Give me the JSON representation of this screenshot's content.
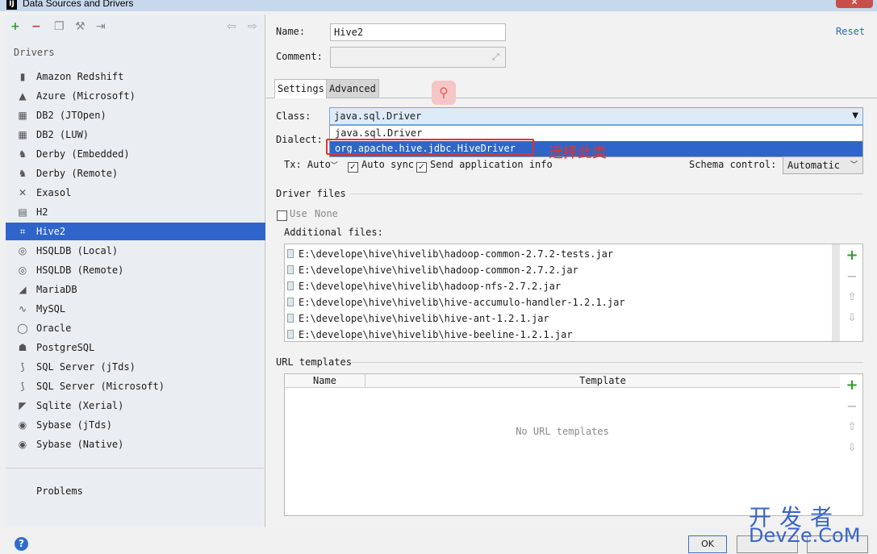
{
  "window": {
    "title": "Data Sources and Drivers"
  },
  "left": {
    "section_label": "Drivers",
    "drivers": [
      {
        "label": "Amazon Redshift",
        "icon": "redshift-icon"
      },
      {
        "label": "Azure (Microsoft)",
        "icon": "azure-icon"
      },
      {
        "label": "DB2 (JTOpen)",
        "icon": "db2-icon"
      },
      {
        "label": "DB2 (LUW)",
        "icon": "db2-icon"
      },
      {
        "label": "Derby (Embedded)",
        "icon": "derby-icon"
      },
      {
        "label": "Derby (Remote)",
        "icon": "derby-icon"
      },
      {
        "label": "Exasol",
        "icon": "exasol-icon"
      },
      {
        "label": "H2",
        "icon": "h2-icon"
      },
      {
        "label": "Hive2",
        "icon": "hive-icon",
        "selected": true
      },
      {
        "label": "HSQLDB (Local)",
        "icon": "hsqldb-icon"
      },
      {
        "label": "HSQLDB (Remote)",
        "icon": "hsqldb-icon"
      },
      {
        "label": "MariaDB",
        "icon": "mariadb-icon"
      },
      {
        "label": "MySQL",
        "icon": "mysql-icon"
      },
      {
        "label": "Oracle",
        "icon": "oracle-icon"
      },
      {
        "label": "PostgreSQL",
        "icon": "postgresql-icon"
      },
      {
        "label": "SQL Server (jTds)",
        "icon": "sqlserver-icon"
      },
      {
        "label": "SQL Server (Microsoft)",
        "icon": "sqlserver-icon"
      },
      {
        "label": "Sqlite (Xerial)",
        "icon": "sqlite-icon"
      },
      {
        "label": "Sybase (jTds)",
        "icon": "sybase-icon"
      },
      {
        "label": "Sybase (Native)",
        "icon": "sybase-icon"
      }
    ],
    "problems_label": "Problems"
  },
  "form": {
    "name_label": "Name:",
    "name_value": "Hive2",
    "comment_label": "Comment:",
    "comment_value": "",
    "reset_label": "Reset"
  },
  "tabs": [
    {
      "label": "Settings"
    },
    {
      "label": "Advanced"
    }
  ],
  "settings": {
    "class_label": "Class:",
    "class_value": "java.sql.Driver",
    "class_options": [
      "java.sql.Driver",
      "org.apache.hive.jdbc.HiveDriver"
    ],
    "dialect_label": "Dialect:",
    "annotation": "选择此类",
    "tx_label": "Tx: Auto",
    "auto_sync_label": "Auto sync",
    "send_info_label": "Send application info",
    "schema_control_label": "Schema control:",
    "schema_control_value": "Automatic"
  },
  "driver_files": {
    "title": "Driver files",
    "use_label": "Use",
    "use_value": "None",
    "additional_label": "Additional files:",
    "files": [
      "E:\\develope\\hive\\hivelib\\hadoop-common-2.7.2-tests.jar",
      "E:\\develope\\hive\\hivelib\\hadoop-common-2.7.2.jar",
      "E:\\develope\\hive\\hivelib\\hadoop-nfs-2.7.2.jar",
      "E:\\develope\\hive\\hivelib\\hive-accumulo-handler-1.2.1.jar",
      "E:\\develope\\hive\\hivelib\\hive-ant-1.2.1.jar",
      "E:\\develope\\hive\\hivelib\\hive-beeline-1.2.1.jar"
    ]
  },
  "url_templates": {
    "title": "URL templates",
    "col_name": "Name",
    "col_template": "Template",
    "empty_text": "No URL templates"
  },
  "footer": {
    "help": "?",
    "ok_label": "OK",
    "watermark_top": "开发者",
    "watermark_bottom": "DevZe.CoM"
  },
  "colors": {
    "selection": "#2f65ca",
    "annotation": "#e0332e",
    "add_green": "#2e9e2e",
    "link": "#2a6bb7"
  }
}
